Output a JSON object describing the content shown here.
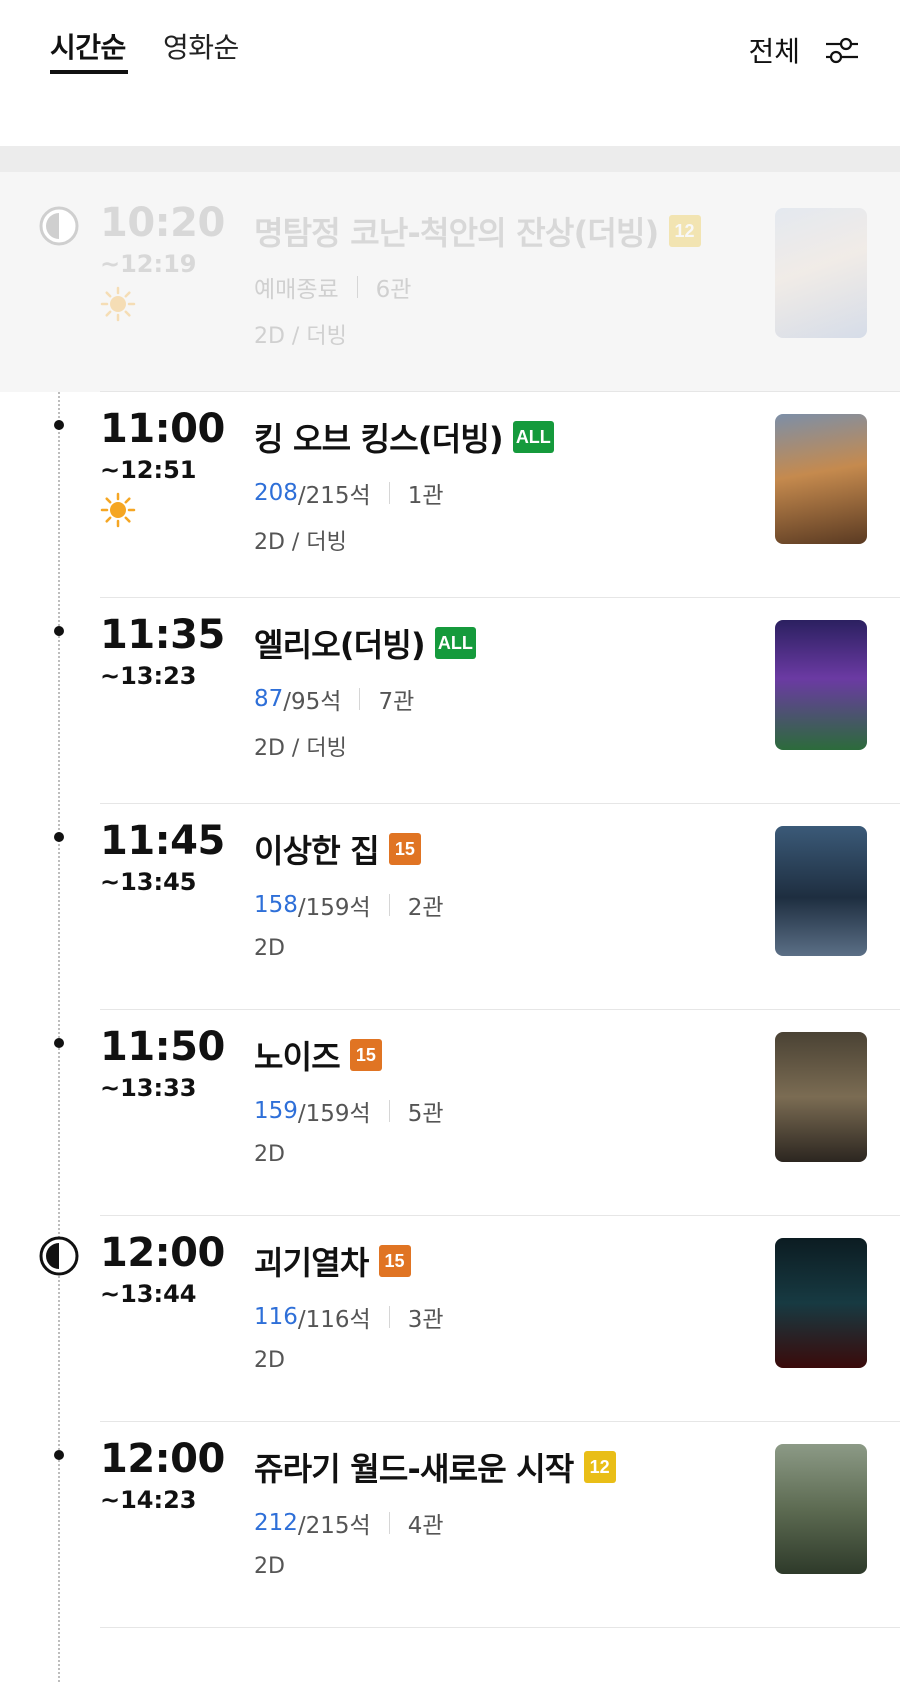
{
  "header": {
    "tabs": [
      {
        "label": "시간순",
        "active": true
      },
      {
        "label": "영화순",
        "active": false
      }
    ],
    "filter_label": "전체",
    "filter_icon": "filter-sliders-icon"
  },
  "colors": {
    "rating_all": "#159a3c",
    "rating_12": "#e9be17",
    "rating_15": "#e07423",
    "seat_available": "#2e6fd8"
  },
  "showtimes": [
    {
      "start": "10:20",
      "end": "~12:19",
      "title": "명탐정 코난-척안의 잔상(더빙)",
      "rating": "12",
      "rating_color": "#e9be17",
      "status": "예매종료",
      "seats_available": "",
      "seats_total": "",
      "hall": "6관",
      "format": "2D / 더빙",
      "morning": true,
      "ended": true,
      "icon": "clock-half-icon"
    },
    {
      "start": "11:00",
      "end": "~12:51",
      "title": "킹 오브 킹스(더빙)",
      "rating": "ALL",
      "rating_color": "#159a3c",
      "status": "",
      "seats_available": "208",
      "seats_total": "/215석",
      "hall": "1관",
      "format": "2D / 더빙",
      "morning": true,
      "ended": false,
      "icon": "dot-icon"
    },
    {
      "start": "11:35",
      "end": "~13:23",
      "title": "엘리오(더빙)",
      "rating": "ALL",
      "rating_color": "#159a3c",
      "status": "",
      "seats_available": "87",
      "seats_total": "/95석",
      "hall": "7관",
      "format": "2D / 더빙",
      "morning": false,
      "ended": false,
      "icon": "dot-icon"
    },
    {
      "start": "11:45",
      "end": "~13:45",
      "title": "이상한 집",
      "rating": "15",
      "rating_color": "#e07423",
      "status": "",
      "seats_available": "158",
      "seats_total": "/159석",
      "hall": "2관",
      "format": "2D",
      "morning": false,
      "ended": false,
      "icon": "dot-icon"
    },
    {
      "start": "11:50",
      "end": "~13:33",
      "title": "노이즈",
      "rating": "15",
      "rating_color": "#e07423",
      "status": "",
      "seats_available": "159",
      "seats_total": "/159석",
      "hall": "5관",
      "format": "2D",
      "morning": false,
      "ended": false,
      "icon": "dot-icon"
    },
    {
      "start": "12:00",
      "end": "~13:44",
      "title": "괴기열차",
      "rating": "15",
      "rating_color": "#e07423",
      "status": "",
      "seats_available": "116",
      "seats_total": "/116석",
      "hall": "3관",
      "format": "2D",
      "morning": false,
      "ended": false,
      "icon": "clock-half-icon"
    },
    {
      "start": "12:00",
      "end": "~14:23",
      "title": "쥬라기 월드-새로운 시작",
      "rating": "12",
      "rating_color": "#e9be17",
      "status": "",
      "seats_available": "212",
      "seats_total": "/215석",
      "hall": "4관",
      "format": "2D",
      "morning": false,
      "ended": false,
      "icon": "dot-icon"
    }
  ]
}
